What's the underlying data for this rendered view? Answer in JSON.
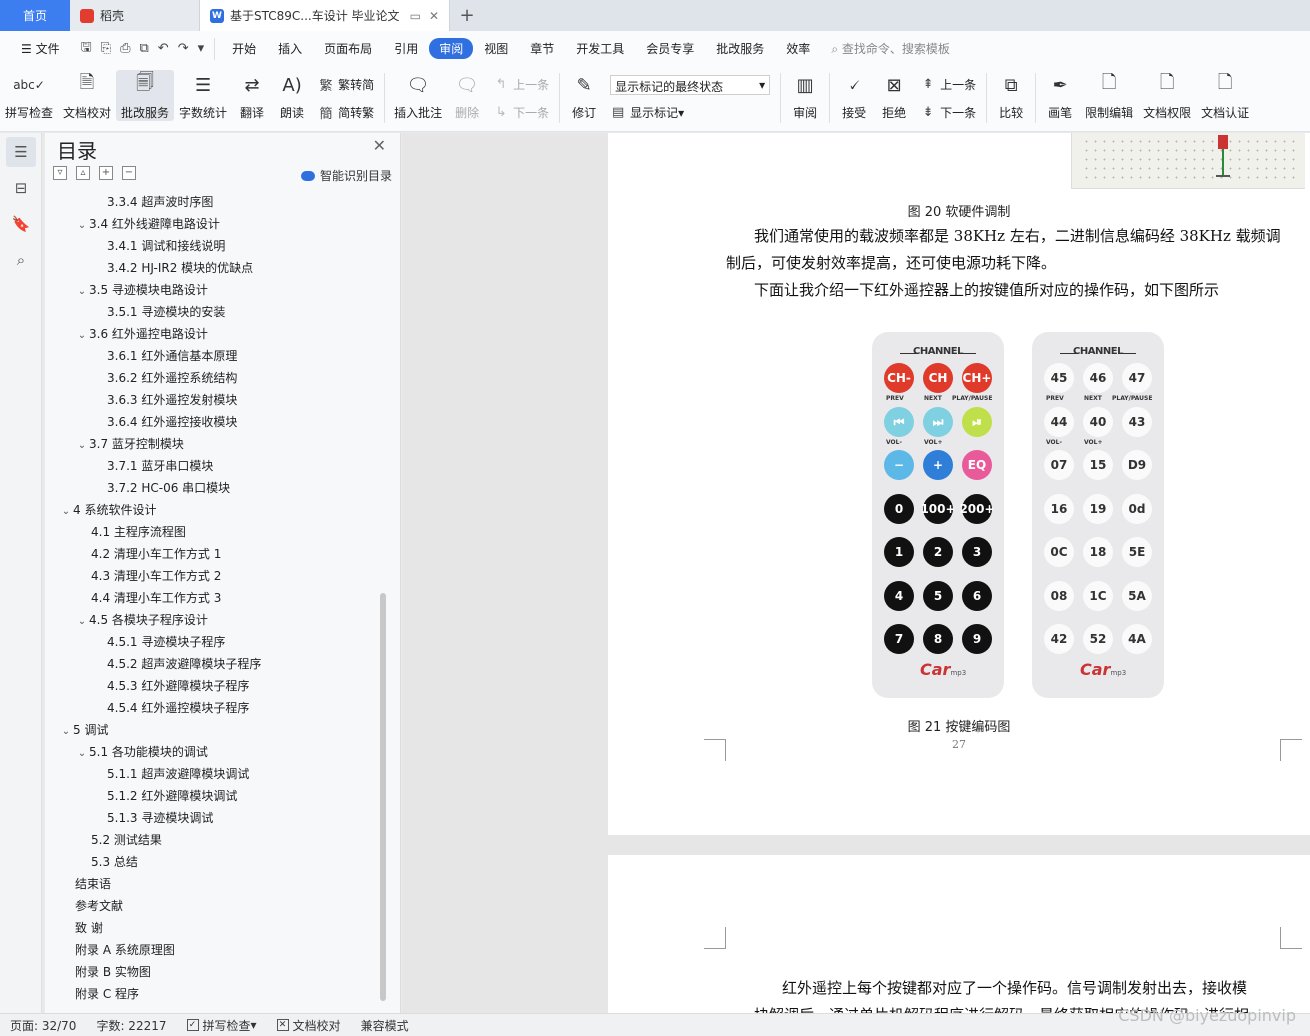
{
  "tabs": {
    "home": "首页",
    "items": [
      {
        "label": "稻壳"
      },
      {
        "label": "基于STC89C...车设计 毕业论文"
      }
    ]
  },
  "menu": {
    "file": "文件",
    "items": [
      "开始",
      "插入",
      "页面布局",
      "引用",
      "审阅",
      "视图",
      "章节",
      "开发工具",
      "会员专享",
      "批改服务",
      "效率"
    ],
    "active_index": 4,
    "search": "查找命令、搜索模板"
  },
  "ribbon": {
    "spell": "拼写检查",
    "doc_check": "文档校对",
    "revise_service": "批改服务",
    "word_count": "字数统计",
    "translate": "翻译",
    "read_aloud": "朗读",
    "trad": "繁转简",
    "simp": "简转繁",
    "insert_comment": "插入批注",
    "delete": "删除",
    "prev": "上一条",
    "next": "下一条",
    "revise": "修订",
    "markup_state": "显示标记的最终状态",
    "show_markup": "显示标记",
    "review": "审阅",
    "accept": "接受",
    "reject": "拒绝",
    "prev2": "上一条",
    "next2": "下一条",
    "compare": "比较",
    "pen": "画笔",
    "restrict": "限制编辑",
    "rights": "文档权限",
    "auth": "文档认证"
  },
  "toc": {
    "title": "目录",
    "smart": "智能识别目录",
    "items": [
      {
        "level": "l3",
        "text": "3.3.4 超声波时序图"
      },
      {
        "level": "l2",
        "caret": "v",
        "text": "3.4 红外线避障电路设计"
      },
      {
        "level": "l3",
        "text": "3.4.1 调试和接线说明"
      },
      {
        "level": "l3",
        "text": "3.4.2 HJ-IR2 模块的优缺点"
      },
      {
        "level": "l2",
        "caret": "v",
        "text": "3.5 寻迹模块电路设计"
      },
      {
        "level": "l3",
        "text": "3.5.1 寻迹模块的安装"
      },
      {
        "level": "l2",
        "caret": "v",
        "text": "3.6 红外遥控电路设计"
      },
      {
        "level": "l3",
        "text": "3.6.1 红外通信基本原理"
      },
      {
        "level": "l3",
        "text": "3.6.2 红外遥控系统结构"
      },
      {
        "level": "l3",
        "text": "3.6.3 红外遥控发射模块"
      },
      {
        "level": "l3",
        "text": "3.6.4 红外遥控接收模块"
      },
      {
        "level": "l2",
        "caret": "v",
        "text": "3.7 蓝牙控制模块"
      },
      {
        "level": "l3",
        "text": "3.7.1 蓝牙串口模块"
      },
      {
        "level": "l3",
        "text": "3.7.2 HC-06 串口模块"
      },
      {
        "level": "l1",
        "caret": "v",
        "text": "4 系统软件设计"
      },
      {
        "level": "l2n",
        "text": "4.1 主程序流程图"
      },
      {
        "level": "l2n",
        "text": "4.2 清理小车工作方式 1"
      },
      {
        "level": "l2n",
        "text": "4.3 清理小车工作方式 2"
      },
      {
        "level": "l2n",
        "text": "4.4 清理小车工作方式 3"
      },
      {
        "level": "l2",
        "caret": "v",
        "text": "4.5 各模块子程序设计"
      },
      {
        "level": "l3",
        "text": "4.5.1 寻迹模块子程序"
      },
      {
        "level": "l3",
        "text": "4.5.2 超声波避障模块子程序"
      },
      {
        "level": "l3",
        "text": "4.5.3 红外避障模块子程序"
      },
      {
        "level": "l3",
        "text": "4.5.4 红外遥控模块子程序"
      },
      {
        "level": "l1",
        "caret": "v",
        "text": "5 调试"
      },
      {
        "level": "l2",
        "caret": "v",
        "text": "5.1 各功能模块的调试"
      },
      {
        "level": "l3",
        "text": "5.1.1 超声波避障模块调试"
      },
      {
        "level": "l3",
        "text": "5.1.2 红外避障模块调试"
      },
      {
        "level": "l3",
        "text": "5.1.3 寻迹模块调试"
      },
      {
        "level": "l2n",
        "text": "5.2 测试结果"
      },
      {
        "level": "l2n",
        "text": "5.3 总结"
      },
      {
        "level": "l1n",
        "text": "结束语"
      },
      {
        "level": "l1n",
        "text": "参考文献"
      },
      {
        "level": "l1n",
        "text": "致 谢"
      },
      {
        "level": "l1n",
        "text": "附录 A 系统原理图"
      },
      {
        "level": "l1n",
        "text": "附录 B 实物图"
      },
      {
        "level": "l1n",
        "text": "附录 C 程序"
      }
    ]
  },
  "document": {
    "fig20_caption": "图 20 软硬件调制",
    "para1_line1": "我们通常使用的载波频率都是 38KHz 左右，二进制信息编码经 38KHz 载频调",
    "para1_line2": "制后，可使发射效率提高，还可使电源功耗下降。",
    "para2": "下面让我介绍一下红外遥控器上的按键值所对应的操作码，如下图所示",
    "fig21_caption": "图 21 按键编码图",
    "page_number": "27",
    "page2_line1": "红外遥控上每个按键都对应了一个操作码。信号调制发射出去，接收模",
    "page2_line2": "块解调后，通过单片机解码程序进行解码，最终获取相应的操作码，进行相"
  },
  "remote_left": {
    "channel": "CHANNEL",
    "row1": [
      "CH-",
      "CH",
      "CH+"
    ],
    "row1_sub": [
      "PREV",
      "NEXT",
      "PLAY/PAUSE"
    ],
    "row2": [
      "⏮",
      "⏭",
      "⏯"
    ],
    "row2_sub": [
      "VOL-",
      "VOL+"
    ],
    "row3": [
      "−",
      "+",
      "EQ"
    ],
    "row4": [
      "0",
      "100+",
      "200+"
    ],
    "row5": [
      "1",
      "2",
      "3"
    ],
    "row6": [
      "4",
      "5",
      "6"
    ],
    "row7": [
      "7",
      "8",
      "9"
    ],
    "logo": "Car",
    "logo_sub": "mp3"
  },
  "remote_right": {
    "channel": "CHANNEL",
    "row1": [
      "45",
      "46",
      "47"
    ],
    "row1_sub": [
      "PREV",
      "NEXT",
      "PLAY/PAUSE"
    ],
    "row2": [
      "44",
      "40",
      "43"
    ],
    "row2_sub": [
      "VOL-",
      "VOL+"
    ],
    "row3": [
      "07",
      "15",
      "D9"
    ],
    "row4": [
      "16",
      "19",
      "0d"
    ],
    "row5": [
      "0C",
      "18",
      "5E"
    ],
    "row6": [
      "08",
      "1C",
      "5A"
    ],
    "row7": [
      "42",
      "52",
      "4A"
    ],
    "logo": "Car",
    "logo_sub": "mp3"
  },
  "status": {
    "page": "页面: 32/70",
    "words": "字数: 22217",
    "spell": "拼写检查",
    "check": "文档校对",
    "compat": "兼容模式"
  },
  "watermark": "CSDN @biyezuopinvip"
}
